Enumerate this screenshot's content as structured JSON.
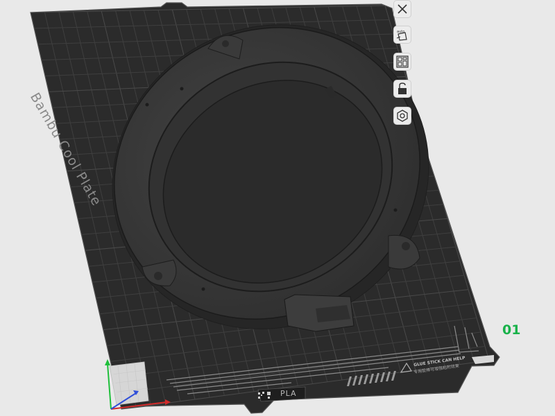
{
  "plate": {
    "name": "Bambu Cool Plate",
    "number": "01",
    "filament_label": "PLA",
    "glue_notice": "GLUE STICK CAN HELP",
    "glue_notice_secondary": "专用胶棒可增强粘附效果"
  },
  "toolbar": {
    "buttons": [
      {
        "name": "close-plate-button",
        "icon": "close-icon"
      },
      {
        "name": "auto-orient-button",
        "icon": "auto-orient-icon"
      },
      {
        "name": "arrange-button",
        "icon": "arrange-icon"
      },
      {
        "name": "lock-button",
        "icon": "lock-icon"
      },
      {
        "name": "plate-settings-button",
        "icon": "hex-nut-icon"
      }
    ]
  },
  "colors": {
    "background": "#e9e9e9",
    "plate": "#2b2b2b",
    "grid": "#3d3d3d",
    "model": "#3a3a3a",
    "plate_number": "#19b24a",
    "axis_x": "#d22a2a",
    "axis_y": "#1fbf3b",
    "axis_z": "#2f4fd9"
  }
}
